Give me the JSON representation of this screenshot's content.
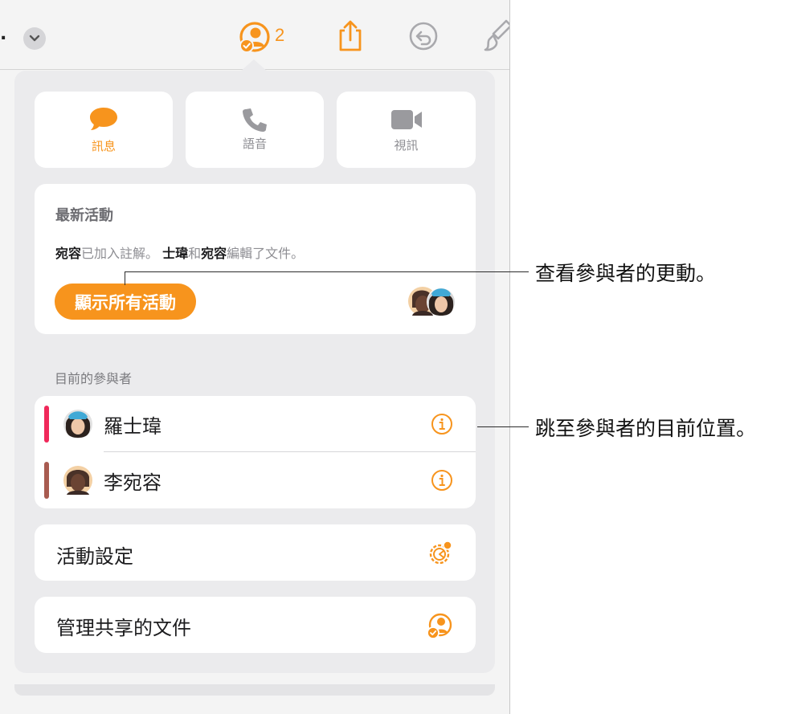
{
  "toolbar": {
    "leading_dots": ".",
    "collab_count": "2"
  },
  "communication": {
    "message_label": "訊息",
    "voice_label": "語音",
    "video_label": "視訊"
  },
  "latest_activity": {
    "title": "最新活動",
    "user1": "宛容",
    "text1": "已加入註解。 ",
    "user2": "士瑋",
    "text2": "和",
    "user3": "宛容",
    "text3": "編輯了文件。",
    "show_all_label": "顯示所有活動"
  },
  "participants": {
    "header": "目前的參與者",
    "items": [
      {
        "name": "羅士瑋",
        "color": "#f0285a"
      },
      {
        "name": "李宛容",
        "color": "#a85b50"
      }
    ]
  },
  "settings": {
    "activity_settings_label": "活動設定",
    "manage_shared_label": "管理共享的文件"
  },
  "callouts": {
    "view_changes": "查看參與者的更動。",
    "jump_to_location": "跳至參與者的目前位置。"
  },
  "colors": {
    "accent": "#f7941d"
  }
}
